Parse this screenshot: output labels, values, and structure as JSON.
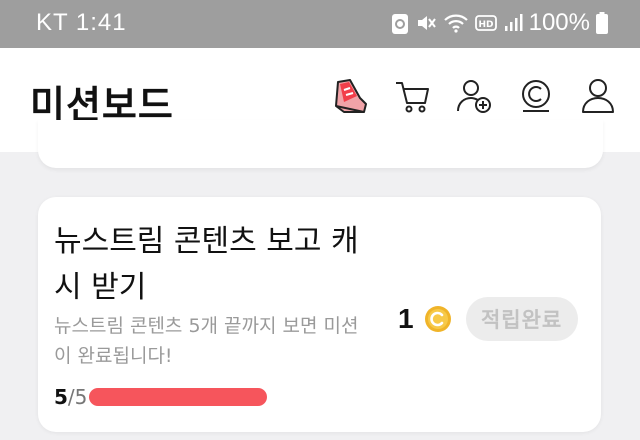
{
  "status_bar": {
    "carrier_time": "KT 1:41",
    "battery": "100%",
    "icons": [
      "recycle-icon",
      "mute-icon",
      "wifi-icon",
      "hd-icon",
      "signal-icon",
      "battery-icon"
    ]
  },
  "header": {
    "title": "미션보드",
    "icons": [
      "sneaker-icon",
      "cart-icon",
      "add-friend-icon",
      "coin-history-icon",
      "profile-icon"
    ]
  },
  "mission": {
    "title": "뉴스트림 콘텐츠 보고 캐시 받기",
    "description": "뉴스트림 콘텐츠 5개 끝까지 보면 미션이 완료됩니다!",
    "progress_done": "5",
    "progress_total": "/5",
    "progress_fraction": 1.0,
    "reward_amount": "1",
    "reward_icon": "coin-icon",
    "status_button": "적립완료"
  },
  "colors": {
    "progress": "#f6555c",
    "coin": "#f0b429",
    "status_bar": "#9e9e9e"
  }
}
